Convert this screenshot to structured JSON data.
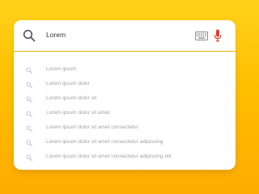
{
  "search": {
    "query": "Lorem"
  },
  "icons": {
    "search": "search-icon",
    "keyboard": "keyboard-icon",
    "microphone": "microphone-icon",
    "suggestion": "search-icon"
  },
  "colors": {
    "background": "#ffbf00",
    "microphone": "#e33b2e",
    "suggestion_text": "#a3a3a3"
  },
  "suggestions": [
    "Lorem ipsum",
    "Lorem ipsum dolor",
    "Lorem ipsum dolor sit",
    "Lorem ipsum dolor sit amet",
    "Lorem ipsum dolor sit amet consectetur",
    "Lorem ipsum dolor sit amet consectetur adipiscing",
    "Lorem ipsum dolor sit amet consectetur adipiscing elit"
  ]
}
